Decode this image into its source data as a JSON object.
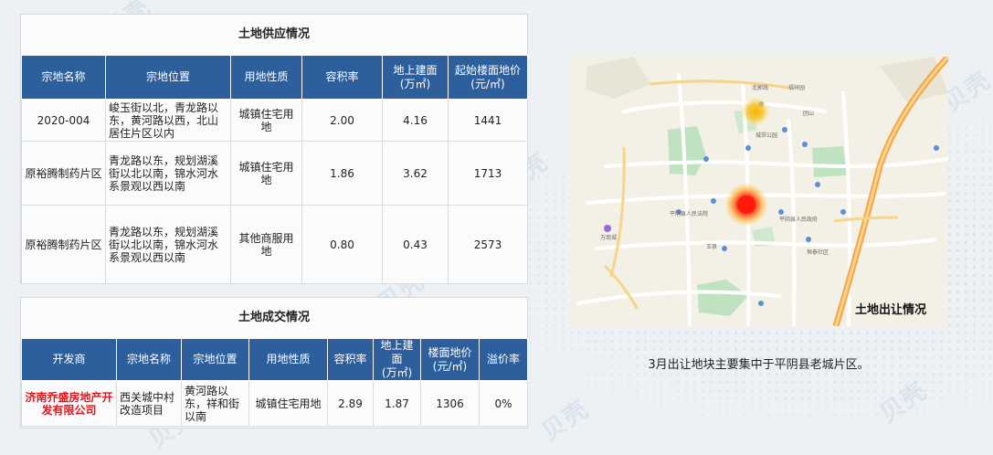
{
  "supply": {
    "title": "土地供应情况",
    "headers": [
      "宗地名称",
      "宗地位置",
      "用地性质",
      "容积率",
      "地上建面\n(万㎡)",
      "起始楼面地价\n(元/㎡)"
    ],
    "rows": [
      [
        "2020-004",
        "峻玉街以北，青龙路以东，黄河路以西，北山居住片区以内",
        "城镇住宅用地",
        "2.00",
        "4.16",
        "1441"
      ],
      [
        "原裕腾制药片区",
        "青龙路以东，规划湖溪街以北以南，锦水河水系景观以西以南",
        "城镇住宅用地",
        "1.86",
        "3.62",
        "1713"
      ],
      [
        "原裕腾制药片区",
        "青龙路以东，规划湖溪街以北以南，锦水河水系景观以西以南",
        "其他商服用地",
        "0.80",
        "0.43",
        "2573"
      ]
    ]
  },
  "deal": {
    "title": "土地成交情况",
    "headers": [
      "开发商",
      "宗地名称",
      "宗地位置",
      "用地性质",
      "容积率",
      "地上建面\n(万㎡)",
      "楼面地价\n(元/㎡)",
      "溢价率"
    ],
    "rows": [
      [
        "济南乔盛房地产开发有限公司",
        "西关城中村改造项目",
        "黄河路以东，祥和街以南",
        "城镇住宅用地",
        "2.89",
        "1.87",
        "1306",
        "0%"
      ]
    ]
  },
  "map": {
    "title": "土地出让情况",
    "labels": {
      "beishan": "北郭线",
      "fangfu": "福祥园",
      "tuanshan": "团山",
      "chengtai": "城郊公园",
      "pingyin": "平阴县人民法院",
      "shizheng": "平阴县人民政府",
      "yuquan": "玉泉",
      "wanda": "万商城",
      "hengtai": "恒泰社区"
    },
    "colors": {
      "hot": "#ff1a0a",
      "warm": "#f5b400"
    }
  },
  "caption": "3月出让地块主要集中于平阴县老城片区。",
  "watermark": "贝壳"
}
